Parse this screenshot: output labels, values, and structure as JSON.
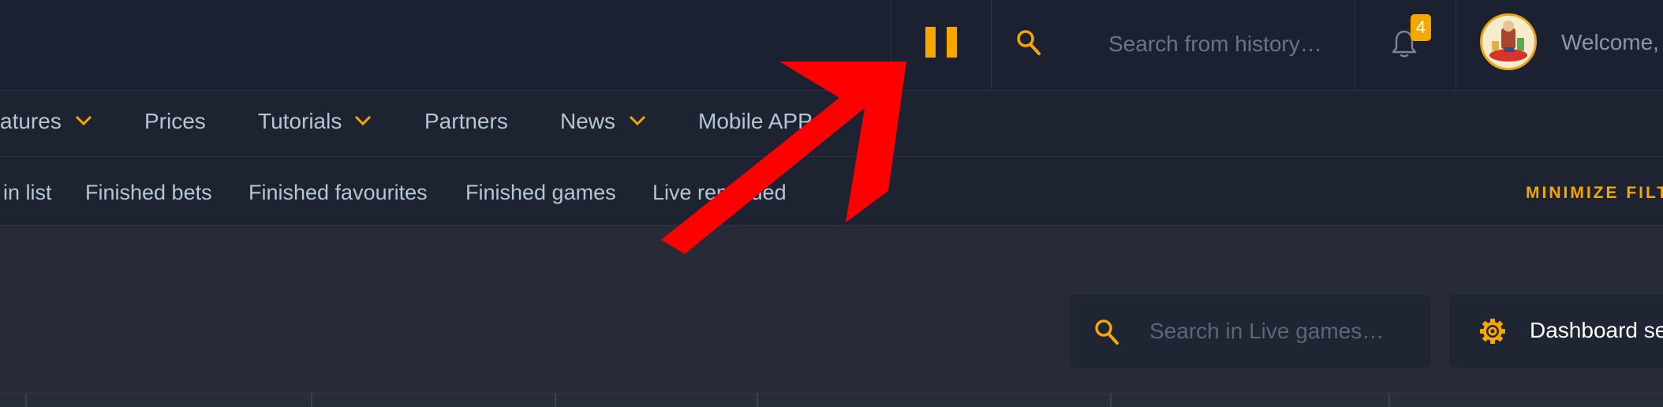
{
  "topbar": {
    "search_placeholder": "Search from history…",
    "notifications_count": "4",
    "welcome_text": "Welcome,"
  },
  "nav": {
    "items": [
      {
        "label": "atures",
        "has_dropdown": true
      },
      {
        "label": "Prices",
        "has_dropdown": false
      },
      {
        "label": "Tutorials",
        "has_dropdown": true
      },
      {
        "label": "Partners",
        "has_dropdown": false
      },
      {
        "label": "News",
        "has_dropdown": true
      },
      {
        "label": "Mobile APP",
        "has_dropdown": false
      }
    ]
  },
  "filters": {
    "items": [
      "in list",
      "Finished bets",
      "Finished favourites",
      "Finished games",
      "Live reminded"
    ],
    "minimize_label": "MINIMIZE FILTERS"
  },
  "content": {
    "live_search_placeholder": "Search in Live games…",
    "dashboard_label": "Dashboard settings"
  },
  "colors": {
    "accent": "#f5a700",
    "annotation_arrow": "#ff0000",
    "topbar_bg": "#1b2130",
    "content_bg": "#262b37",
    "nav_text": "#b4c6d4"
  },
  "icons": [
    "pause-icon",
    "search-icon",
    "bell-icon",
    "chevron-down-icon",
    "gear-icon",
    "annotation-arrow"
  ]
}
